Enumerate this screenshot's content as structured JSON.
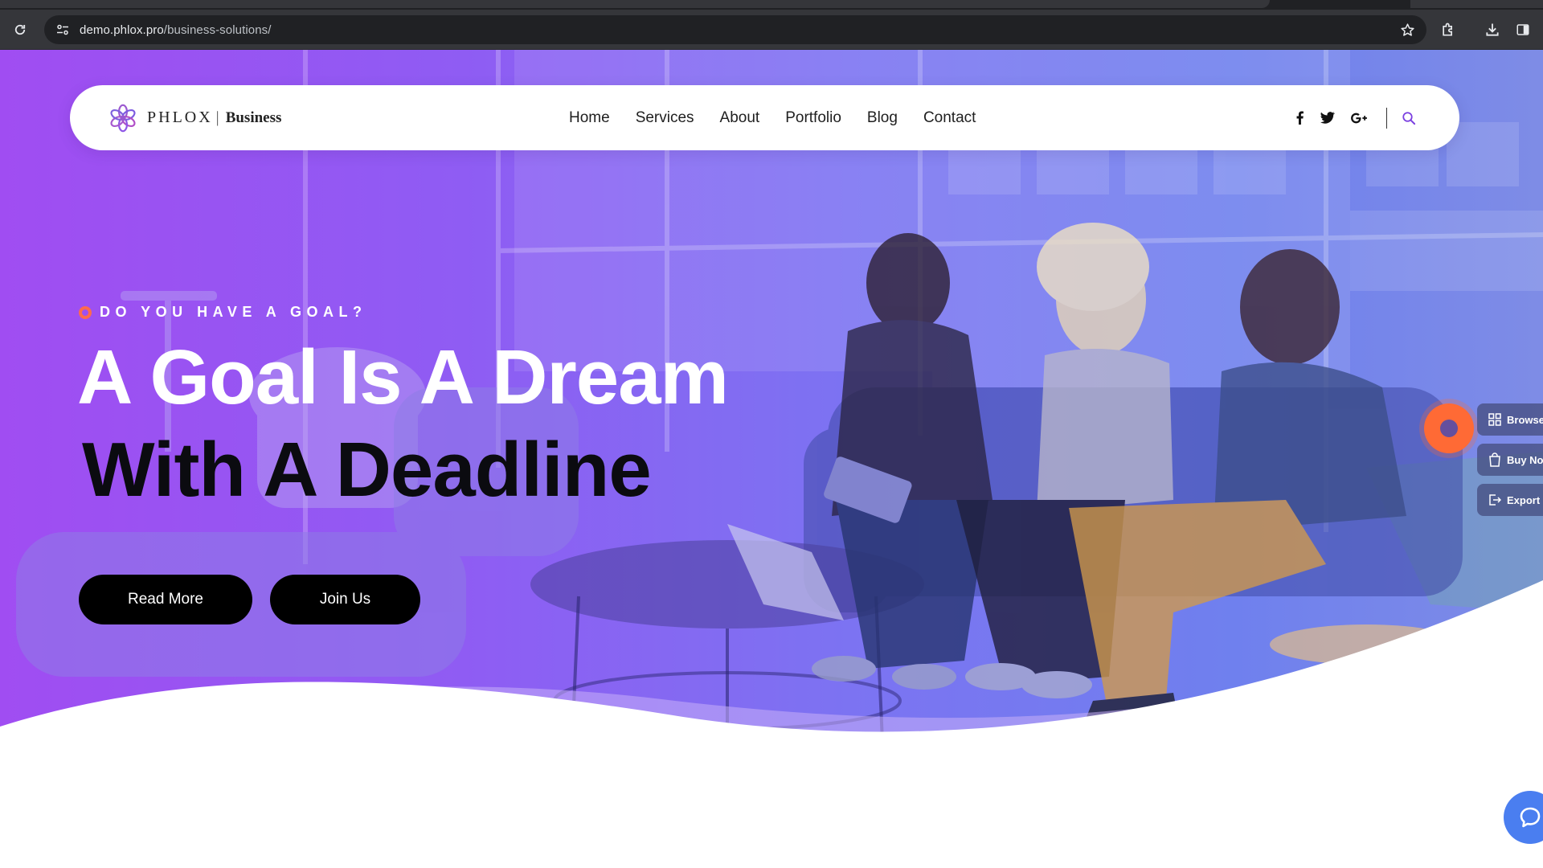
{
  "browser": {
    "url_host": "demo.phlox.pro",
    "url_path": "/business-solutions/"
  },
  "header": {
    "logo_brand": "PHLOX",
    "logo_separator": "|",
    "logo_sub": "Business",
    "nav": [
      {
        "label": "Home"
      },
      {
        "label": "Services"
      },
      {
        "label": "About"
      },
      {
        "label": "Portfolio"
      },
      {
        "label": "Blog"
      },
      {
        "label": "Contact"
      }
    ],
    "social": [
      {
        "name": "facebook-icon",
        "glyph": "f"
      },
      {
        "name": "twitter-icon",
        "glyph": "twitter"
      },
      {
        "name": "google-plus-icon",
        "glyph": "G+"
      }
    ]
  },
  "hero": {
    "eyebrow": "DO YOU HAVE A GOAL?",
    "title_line1": "A Goal Is A Dream",
    "title_line2": "With A Deadline",
    "buttons": {
      "read_more": "Read More",
      "join_us": "Join Us"
    }
  },
  "side_panel": {
    "browse": "Browse",
    "buy_now": "Buy No",
    "export": "Export :"
  },
  "colors": {
    "accent_orange": "#ff6a4d",
    "hero_purple": "#a04df2",
    "hero_blue": "#6f80ee",
    "button_black": "#000000",
    "chat_blue": "#4a7ef0"
  }
}
